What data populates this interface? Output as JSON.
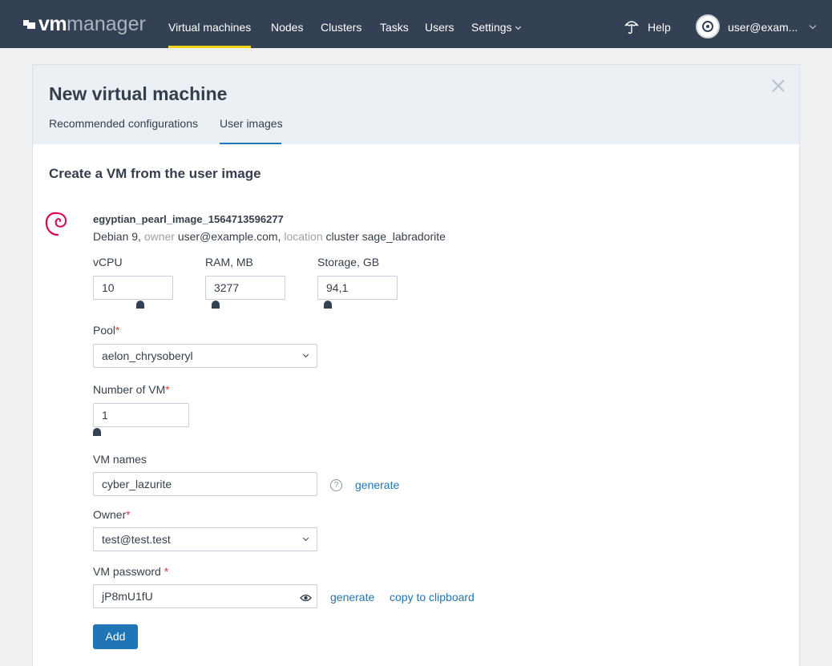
{
  "header": {
    "logo": {
      "vm": "vm",
      "manager": "manager"
    },
    "nav": [
      {
        "label": "Virtual machines",
        "active": true
      },
      {
        "label": "Nodes"
      },
      {
        "label": "Clusters"
      },
      {
        "label": "Tasks"
      },
      {
        "label": "Users"
      },
      {
        "label": "Settings"
      }
    ],
    "help_label": "Help",
    "user_label": "user@exam..."
  },
  "dialog": {
    "title": "New virtual machine",
    "tabs": [
      {
        "label": "Recommended configurations",
        "active": false
      },
      {
        "label": "User images",
        "active": true
      }
    ],
    "section_title": "Create a VM from the user image",
    "image": {
      "name": "egyptian_pearl_image_1564713596277",
      "os": "Debian 9,",
      "owner_label": "owner",
      "owner": "user@example.com,",
      "location_label": "location",
      "location": "cluster sage_labradorite"
    },
    "form": {
      "vcpu": {
        "label": "vCPU",
        "value": "10"
      },
      "ram": {
        "label": "RAM, MB",
        "value": "3277"
      },
      "storage": {
        "label": "Storage, GB",
        "value": "94,1"
      },
      "pool": {
        "label": "Pool",
        "required": "*",
        "value": "aelon_chrysoberyl"
      },
      "count": {
        "label": "Number of VM",
        "required": "*",
        "value": "1"
      },
      "names": {
        "label": "VM names",
        "value": "cyber_lazurite",
        "help": "?",
        "generate": "generate"
      },
      "owner": {
        "label": "Owner",
        "required": "*",
        "value": "test@test.test"
      },
      "password": {
        "label": "VM password",
        "required": "*",
        "value": "jP8mU1fU",
        "generate": "generate",
        "copy": "copy to clipboard"
      },
      "submit": "Add"
    }
  },
  "colors": {
    "topbar": "#344154",
    "accent": "#1f75b5",
    "active_underline": "#f0d515",
    "required": "#e0363b"
  }
}
